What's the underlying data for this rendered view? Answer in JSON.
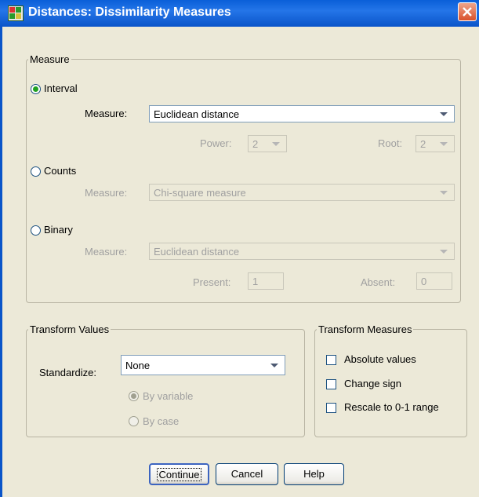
{
  "window": {
    "title": "Distances: Dissimilarity Measures"
  },
  "measure": {
    "legend": "Measure",
    "interval": {
      "label": "Interval",
      "selected": true,
      "measure_label": "Measure:",
      "measure_value": "Euclidean distance",
      "power_label": "Power:",
      "power_value": "2",
      "root_label": "Root:",
      "root_value": "2"
    },
    "counts": {
      "label": "Counts",
      "selected": false,
      "measure_label": "Measure:",
      "measure_value": "Chi-square measure"
    },
    "binary": {
      "label": "Binary",
      "selected": false,
      "measure_label": "Measure:",
      "measure_value": "Euclidean distance",
      "present_label": "Present:",
      "present_value": "1",
      "absent_label": "Absent:",
      "absent_value": "0"
    }
  },
  "transform_values": {
    "legend": "Transform Values",
    "standardize_label": "Standardize:",
    "standardize_value": "None",
    "by_variable": "By variable",
    "by_case": "By case",
    "selected": "By variable"
  },
  "transform_measures": {
    "legend": "Transform Measures",
    "absolute": "Absolute values",
    "change_sign": "Change sign",
    "rescale": "Rescale to 0-1 range",
    "checked": []
  },
  "buttons": {
    "continue": "Continue",
    "cancel": "Cancel",
    "help": "Help"
  },
  "colors": {
    "title_bar": "#0a5fd8",
    "dialog_bg": "#ece9d8",
    "radio_selected": "#21a121",
    "close_button": "#d9512b"
  },
  "icons": {
    "app": "spss-dialog-icon",
    "close": "close-x-icon"
  }
}
